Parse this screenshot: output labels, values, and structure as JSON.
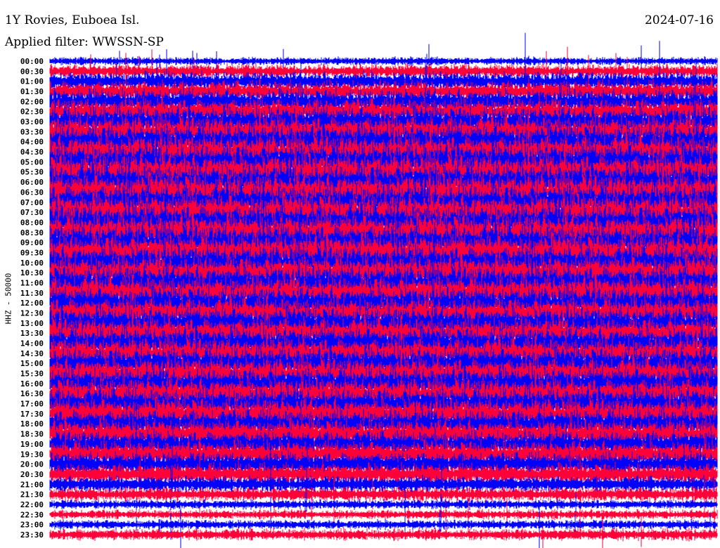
{
  "chart_data": {
    "type": "line",
    "title": "1Y Rovies, Euboea Isl.",
    "subtitle": "Applied filter: WWSSN-SP",
    "date": "2024-07-16",
    "ylabel": "HHZ - 50000",
    "xlabel": "",
    "colors": [
      "#0000ff",
      "#ff0038"
    ],
    "rows": [
      "00:00",
      "00:30",
      "01:00",
      "01:30",
      "02:00",
      "02:30",
      "03:00",
      "03:30",
      "04:00",
      "04:30",
      "05:00",
      "05:30",
      "06:00",
      "06:30",
      "07:00",
      "07:30",
      "08:00",
      "08:30",
      "09:00",
      "09:30",
      "10:00",
      "10:30",
      "11:00",
      "11:30",
      "12:00",
      "12:30",
      "13:00",
      "13:30",
      "14:00",
      "14:30",
      "15:00",
      "15:30",
      "16:00",
      "16:30",
      "17:00",
      "17:30",
      "18:00",
      "18:30",
      "19:00",
      "19:30",
      "20:00",
      "20:30",
      "21:00",
      "21:30",
      "22:00",
      "22:30",
      "23:00",
      "23:30"
    ],
    "relative_amplitude": [
      0.35,
      0.6,
      0.8,
      0.9,
      1.0,
      1.1,
      1.2,
      1.3,
      1.4,
      1.4,
      1.5,
      1.5,
      1.5,
      1.5,
      1.5,
      1.5,
      1.5,
      1.5,
      1.5,
      1.5,
      1.4,
      1.4,
      1.4,
      1.4,
      1.3,
      1.3,
      1.3,
      1.3,
      1.3,
      1.3,
      1.3,
      1.3,
      1.3,
      1.3,
      1.3,
      1.3,
      1.2,
      1.2,
      1.1,
      1.1,
      1.0,
      0.9,
      0.7,
      0.6,
      0.4,
      0.4,
      0.4,
      0.5
    ],
    "minutes_per_row": 30
  }
}
